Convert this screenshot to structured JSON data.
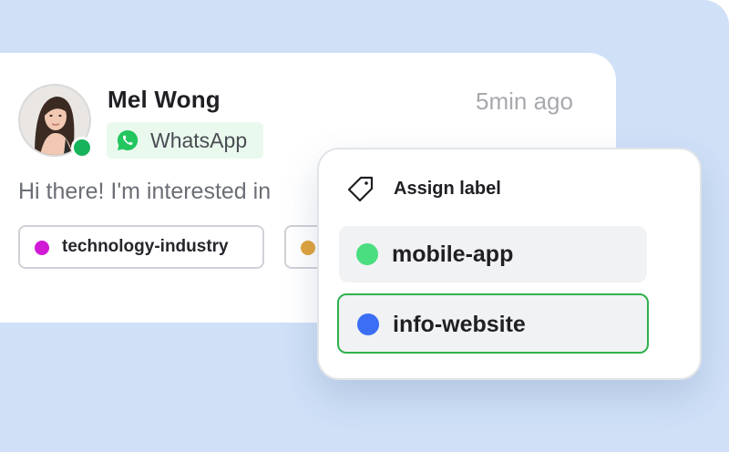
{
  "conversation": {
    "contact_name": "Mel Wong",
    "time_ago": "5min ago",
    "channel": {
      "label": "WhatsApp",
      "icon": "whatsapp-icon",
      "color": "#22c55e"
    },
    "status": {
      "icon": "online-status-dot",
      "color": "#16b35a"
    },
    "message_preview": "Hi there! I'm interested in",
    "labels": [
      {
        "label": "technology-industry",
        "color": "#d11ad6"
      },
      {
        "label": "",
        "color": "#e0a33c"
      }
    ]
  },
  "assign_label_popup": {
    "title": "Assign label",
    "title_icon": "tag-icon",
    "options": [
      {
        "label": "mobile-app",
        "color": "#4ade80",
        "selected": false
      },
      {
        "label": "info-website",
        "color": "#3b6ef5",
        "selected": true
      }
    ]
  },
  "colors": {
    "background": "#cfe0f7",
    "selected_border": "#2fb24f"
  }
}
